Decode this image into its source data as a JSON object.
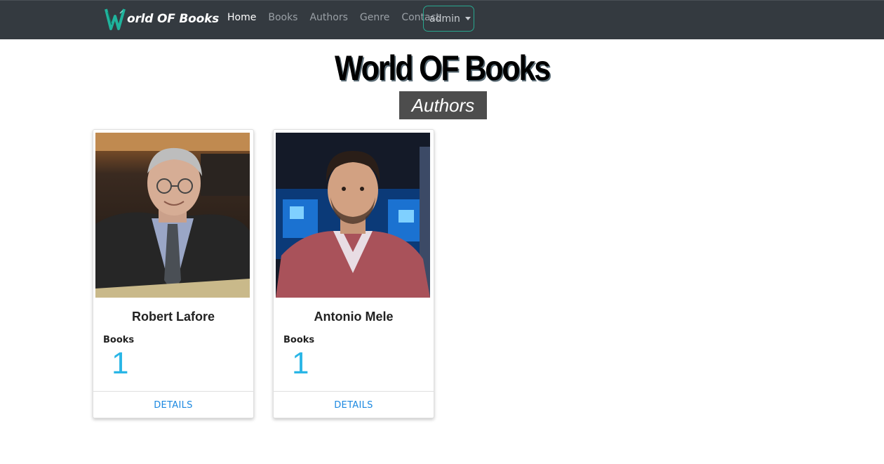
{
  "navbar": {
    "brand": "orld OF Books",
    "links": [
      "Home",
      "Books",
      "Authors",
      "Genre",
      "Contact"
    ],
    "user_menu": "admin",
    "active_link": "Home"
  },
  "header": {
    "title": "World OF Books",
    "section": "Authors"
  },
  "authors": [
    {
      "name": "Robert Lafore",
      "books_label": "Books",
      "books_count": "1",
      "action": "DETAILS"
    },
    {
      "name": "Antonio Mele",
      "books_label": "Books",
      "books_count": "1",
      "action": "DETAILS"
    }
  ],
  "colors": {
    "navbar_bg": "#343a40",
    "accent_teal": "#28a78f",
    "count_blue": "#2ab6e6",
    "link_blue": "#1b88e0",
    "label_bg": "#4d4d4d"
  }
}
